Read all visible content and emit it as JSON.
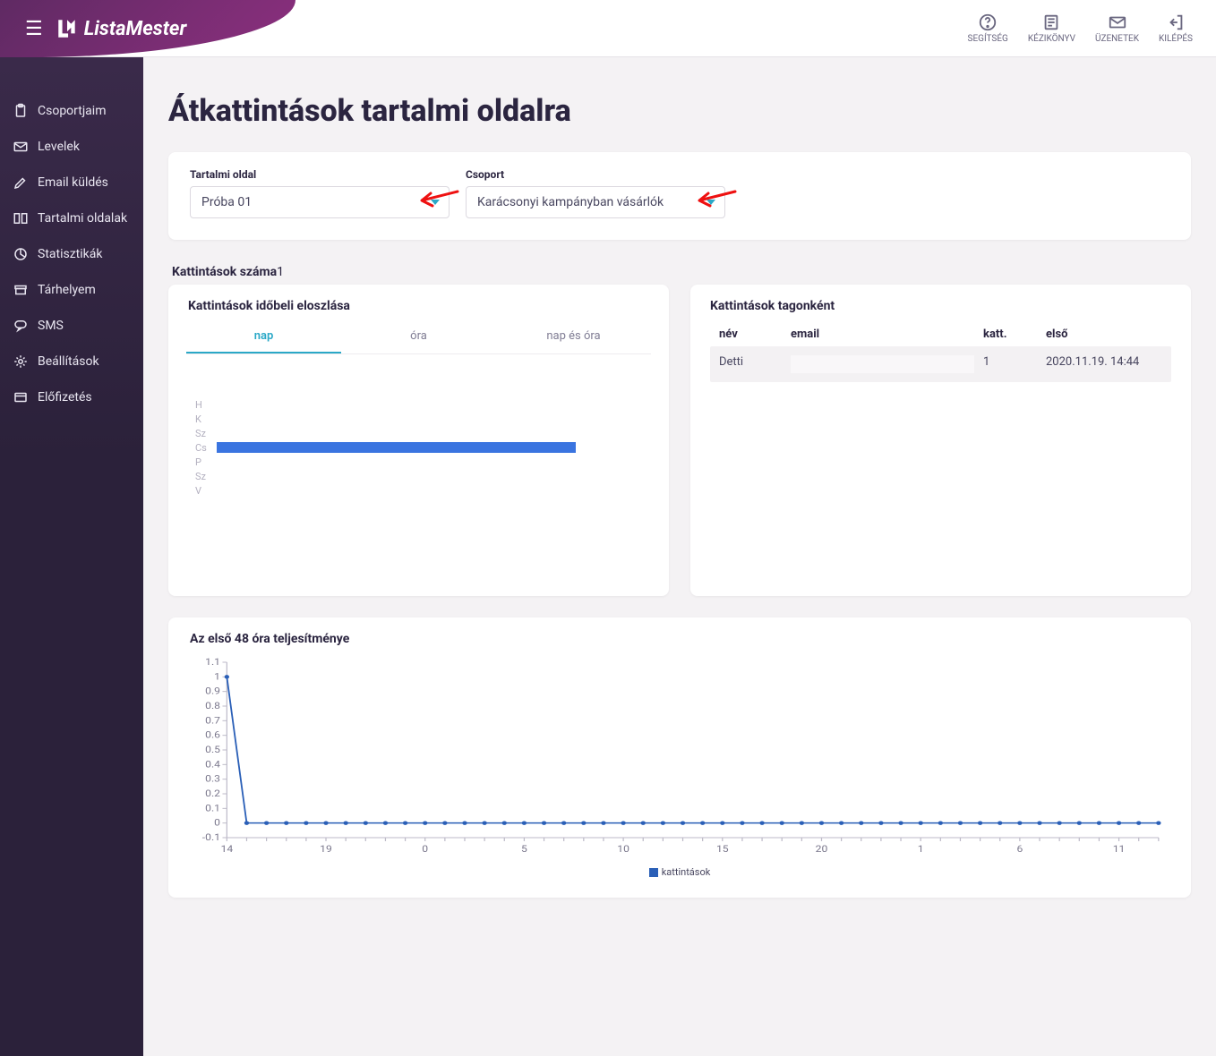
{
  "brand": "ListaMester",
  "header_actions": [
    {
      "name": "help",
      "label": "SEGÍTSÉG"
    },
    {
      "name": "manual",
      "label": "KÉZIKÖNYV"
    },
    {
      "name": "messages",
      "label": "ÜZENETEK"
    },
    {
      "name": "logout",
      "label": "KILÉPÉS"
    }
  ],
  "sidebar": {
    "items": [
      {
        "label": "Csoportjaim"
      },
      {
        "label": "Levelek"
      },
      {
        "label": "Email küldés"
      },
      {
        "label": "Tartalmi oldalak"
      },
      {
        "label": "Statisztikák"
      },
      {
        "label": "Tárhelyem"
      },
      {
        "label": "SMS"
      },
      {
        "label": "Beállítások"
      },
      {
        "label": "Előfizetés"
      }
    ]
  },
  "page": {
    "title": "Átkattintások tartalmi oldalra"
  },
  "filters": {
    "content_page_label": "Tartalmi oldal",
    "content_page_value": "Próba 01",
    "group_label": "Csoport",
    "group_value": "Karácsonyi kampányban vásárlók"
  },
  "clicks_count": {
    "label": "Kattintások száma",
    "value": "1"
  },
  "time_panel": {
    "title": "Kattintások időbeli eloszlása",
    "tabs": [
      {
        "label": "nap",
        "active": true
      },
      {
        "label": "óra",
        "active": false
      },
      {
        "label": "nap és óra",
        "active": false
      }
    ]
  },
  "members_panel": {
    "title": "Kattintások tagonként",
    "headers": {
      "name": "név",
      "email": "email",
      "clicks": "katt.",
      "first": "első"
    },
    "rows": [
      {
        "name": "Detti",
        "email": "",
        "clicks": "1",
        "first": "2020.11.19. 14:44"
      }
    ]
  },
  "chart48": {
    "title": "Az első 48 óra teljesítménye",
    "legend": "kattintások"
  },
  "chart_data": [
    {
      "type": "bar",
      "orientation": "horizontal",
      "title": "Kattintások időbeli eloszlása",
      "categories": [
        "H",
        "K",
        "Sz",
        "Cs",
        "P",
        "Sz",
        "V"
      ],
      "values": [
        0,
        0,
        0,
        1,
        0,
        0,
        0
      ],
      "xlim": [
        0,
        1.2
      ]
    },
    {
      "type": "line",
      "title": "Az első 48 óra teljesítménye",
      "series": [
        {
          "name": "kattintások",
          "values": [
            1,
            0,
            0,
            0,
            0,
            0,
            0,
            0,
            0,
            0,
            0,
            0,
            0,
            0,
            0,
            0,
            0,
            0,
            0,
            0,
            0,
            0,
            0,
            0,
            0,
            0,
            0,
            0,
            0,
            0,
            0,
            0,
            0,
            0,
            0,
            0,
            0,
            0,
            0,
            0,
            0,
            0,
            0,
            0,
            0,
            0,
            0,
            0
          ]
        }
      ],
      "x_tick_labels": [
        "14",
        "",
        "",
        "",
        "",
        "19",
        "",
        "",
        "",
        "",
        "0",
        "",
        "",
        "",
        "",
        "5",
        "",
        "",
        "",
        "",
        "10",
        "",
        "",
        "",
        "",
        "15",
        "",
        "",
        "",
        "",
        "20",
        "",
        "",
        "",
        "",
        "1",
        "",
        "",
        "",
        "",
        "6",
        "",
        "",
        "",
        "",
        "11",
        "",
        ""
      ],
      "y_ticks": [
        -0.1,
        0,
        0.1,
        0.2,
        0.3,
        0.4,
        0.5,
        0.6,
        0.7,
        0.8,
        0.9,
        1,
        1.1
      ],
      "ylim": [
        -0.1,
        1.1
      ],
      "xlabel": "",
      "ylabel": ""
    }
  ],
  "colors": {
    "accent": "#2aa8c7",
    "bar": "#3a74e0",
    "line": "#2a5fb7",
    "brand_gradient_start": "#5f2a63",
    "brand_gradient_end": "#8b2f7e",
    "sidebar_bg": "#2b213a"
  }
}
